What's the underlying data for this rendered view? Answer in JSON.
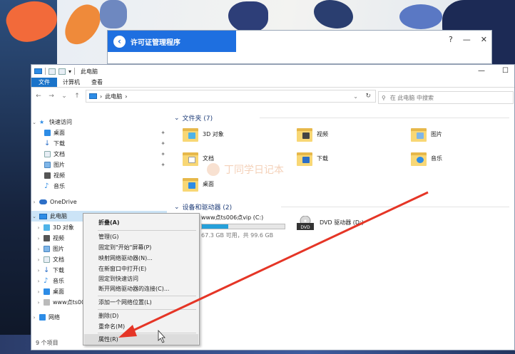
{
  "license": {
    "title": "许可证管理程序",
    "controls": [
      "?",
      "—",
      "✕"
    ]
  },
  "explorer": {
    "title": "此电脑",
    "window_controls": [
      "—",
      "☐"
    ],
    "ribbon": [
      "文件",
      "计算机",
      "查看"
    ],
    "address": {
      "path": "此电脑",
      "separator": "›"
    },
    "search_placeholder": "在 此电脑 中搜索",
    "status": "9 个项目"
  },
  "nav": {
    "quick_access": "快速访问",
    "quick_items": [
      "桌面",
      "下载",
      "文档",
      "图片",
      "视频",
      "音乐"
    ],
    "onedrive": "OneDrive",
    "this_pc": "此电脑",
    "pc_items": [
      "3D 对象",
      "视频",
      "图片",
      "文档",
      "下载",
      "音乐",
      "桌面",
      "www点ts00"
    ],
    "network": "网络"
  },
  "folders_header": "文件夹 (7)",
  "folders": [
    "3D 对象",
    "视频",
    "图片",
    "文档",
    "下载",
    "音乐",
    "桌面"
  ],
  "drives_header": "设备和驱动器 (2)",
  "drives": [
    {
      "name": "www点ts006点vip (C:)",
      "info": "67.3 GB 可用，共 99.6 GB",
      "used_fraction": 0.32
    },
    {
      "name": "DVD 驱动器 (D:)",
      "label": "DVD"
    }
  ],
  "watermark": "丁同学日记本",
  "context_menu": [
    "折叠(A)",
    "管理(G)",
    "固定到\"开始\"屏幕(P)",
    "映射网络驱动器(N)...",
    "在新窗口中打开(E)",
    "固定到快速访问",
    "断开网络驱动器的连接(C)...",
    "添加一个网络位置(L)",
    "删除(D)",
    "重命名(M)",
    "属性(R)"
  ],
  "colors": {
    "accent": "#1a73c9",
    "license_blue": "#1e6fe0",
    "arrow": "#e53526",
    "folder": "#f8d775"
  }
}
